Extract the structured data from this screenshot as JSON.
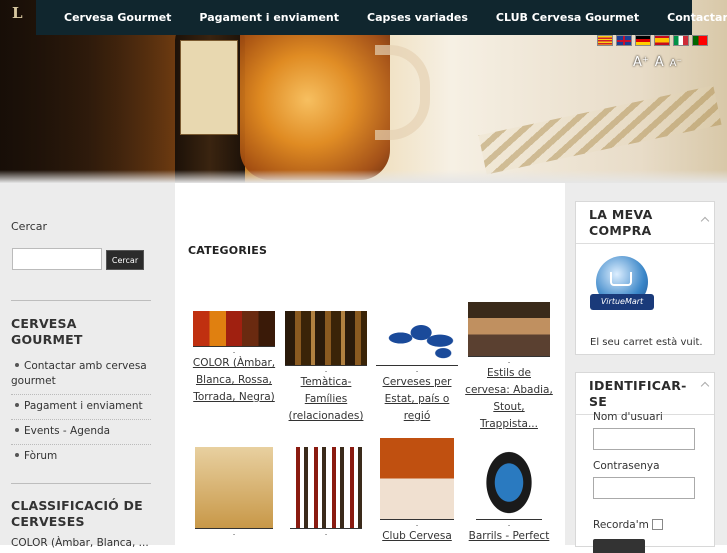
{
  "header": {
    "brand_letter": "L",
    "nav": [
      "Cervesa Gourmet",
      "Pagament i enviament",
      "Capses variades",
      "CLUB Cervesa Gourmet",
      "Contactar"
    ],
    "languages": [
      "flag-catalan-icon",
      "flag-uk-icon",
      "flag-germany-icon",
      "flag-spain-icon",
      "flag-italy-icon",
      "flag-portugal-icon"
    ],
    "font_size": {
      "increase": "A⁺",
      "reset": "A",
      "decrease": "A⁻"
    }
  },
  "left": {
    "search_title": "Cercar",
    "search_placeholder": "",
    "search_button": "Cercar",
    "module1_title": "CERVESA GOURMET",
    "menu": [
      "Contactar amb cervesa gourmet",
      "Pagament i enviament",
      "Events - Agenda",
      "Fòrum"
    ],
    "module2_title": "CLASSIFICACIÓ DE CERVESES",
    "module2_first": "COLOR (Àmbar, Blanca, ..."
  },
  "main": {
    "heading": "CATEGORIES",
    "categories": [
      {
        "label": "COLOR (Àmbar, Blanca, Rossa, Torrada, Negra)",
        "icon": "beer-colors-image"
      },
      {
        "label": "Temàtica-Famílies (relacionades)",
        "icon": "beer-bottles-image"
      },
      {
        "label": "Cerveses per Estat, país o regió",
        "icon": "world-map-image"
      },
      {
        "label": "Estils de cervesa: Abadia, Stout, Trappista...",
        "icon": "bar-taps-image"
      },
      {
        "label": "",
        "icon": "gift-box-image"
      },
      {
        "label": "",
        "icon": "bottle-lineup-image"
      },
      {
        "label": "Club Cervesa",
        "icon": "club-pack-image"
      },
      {
        "label": "Barrils - Perfect",
        "icon": "beer-keg-image"
      }
    ]
  },
  "right": {
    "cart_title": "LA MEVA COMPRA",
    "virtuemart": "VirtueMart",
    "cart_empty": "El seu carret està vuit.",
    "login_title": "IDENTIFICAR-SE",
    "username_label": "Nom d'usuari",
    "password_label": "Contrasenya",
    "remember_label": "Recorda'm"
  }
}
